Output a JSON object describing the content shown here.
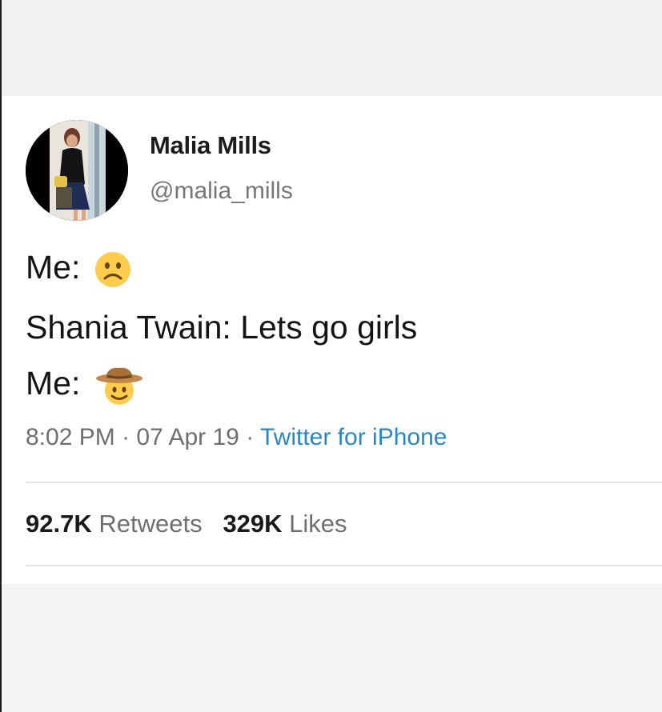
{
  "tweet": {
    "author": {
      "name": "Malia Mills",
      "handle": "@malia_mills",
      "avatar_icon": "profile-photo"
    },
    "lines": [
      {
        "text": "Me:",
        "emoji": "frowning-face-icon"
      },
      {
        "text": "Shania Twain: Lets go girls"
      },
      {
        "text": "Me:",
        "emoji": "cowboy-hat-face-icon"
      }
    ],
    "time": "8:02 PM",
    "date": "07 Apr 19",
    "separator": "·",
    "source": "Twitter for iPhone",
    "retweets_count": "92.7K",
    "retweets_label": "Retweets",
    "likes_count": "329K",
    "likes_label": "Likes"
  },
  "colors": {
    "link": "#2a87c4",
    "emoji_yellow": "#ffcc4d",
    "hat_brown": "#c1884a"
  }
}
